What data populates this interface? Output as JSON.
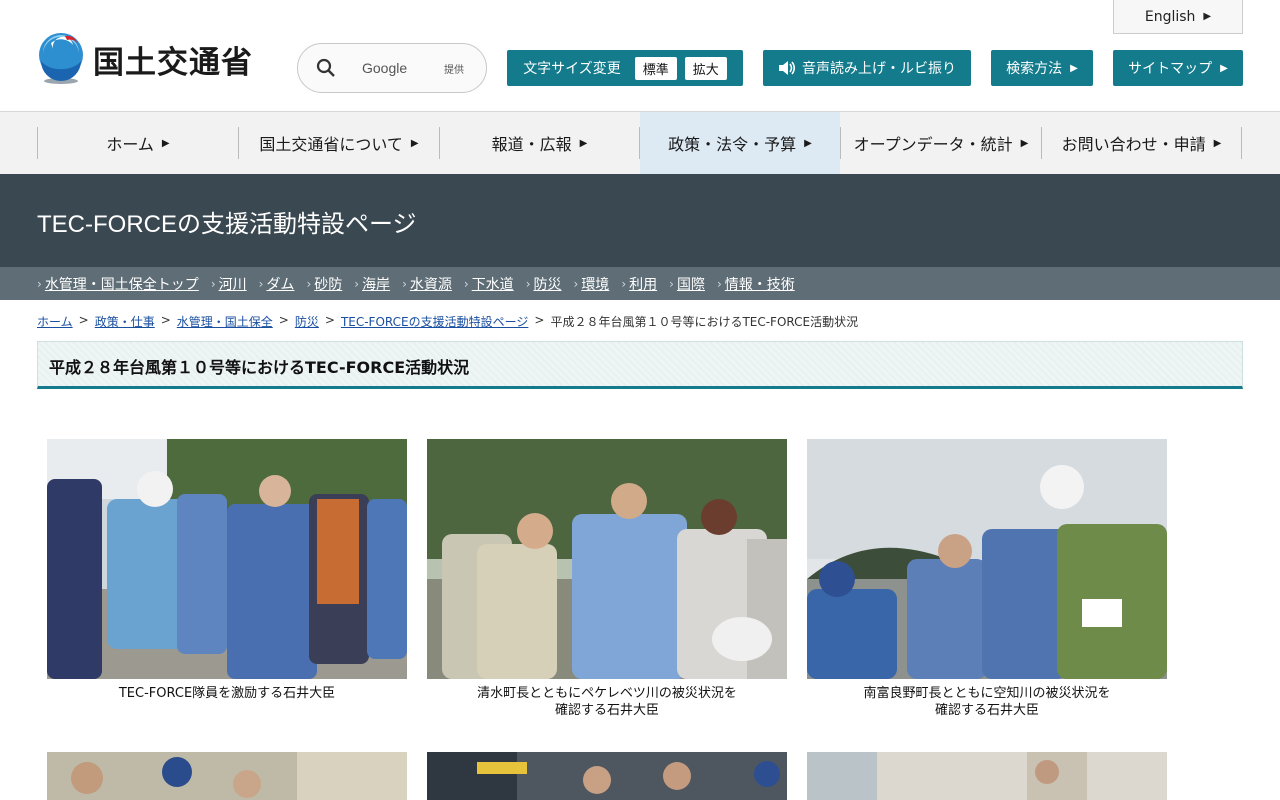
{
  "header": {
    "logo_text": "国土交通省",
    "search": {
      "placeholder": "Google",
      "provided": "提供"
    },
    "english_link": "English",
    "fontsize": {
      "label": "文字サイズ変更",
      "standard": "標準",
      "large": "拡大"
    },
    "voice_label": "音声読み上げ・ルビ振り",
    "howto_label": "検索方法",
    "sitemap_label": "サイトマップ"
  },
  "gnav": {
    "items": [
      {
        "label": "ホーム"
      },
      {
        "label": "国土交通省について"
      },
      {
        "label": "報道・広報"
      },
      {
        "label": "政策・法令・予算"
      },
      {
        "label": "オープンデータ・統計"
      },
      {
        "label": "お問い合わせ・申請"
      }
    ]
  },
  "section": {
    "title": "TEC-FORCEの支援活動特設ページ",
    "links": [
      "水管理・国土保全トップ",
      "河川",
      "ダム",
      "砂防",
      "海岸",
      "水資源",
      "下水道",
      "防災",
      "環境",
      "利用",
      "国際",
      "情報・技術"
    ]
  },
  "breadcrumb": {
    "items": [
      "ホーム",
      "政策・仕事",
      "水管理・国土保全",
      "防災",
      "TEC-FORCEの支援活動特設ページ"
    ],
    "current": "平成２８年台風第１０号等におけるTEC-FORCE活動状況",
    "separator": ">"
  },
  "page": {
    "heading": "平成２８年台風第１０号等におけるTEC-FORCE活動状況"
  },
  "photos": [
    {
      "caption_line1": "TEC-FORCE隊員を激励する石井大臣",
      "caption_line2": ""
    },
    {
      "caption_line1": "清水町長とともにペケレベツ川の被災状況を",
      "caption_line2": "確認する石井大臣"
    },
    {
      "caption_line1": "南富良野町長とともに空知川の被災状況を",
      "caption_line2": "確認する石井大臣"
    }
  ],
  "colors": {
    "teal": "#137b8b",
    "title_band": "#3a4851",
    "sub_nav": "#5e6d76"
  }
}
